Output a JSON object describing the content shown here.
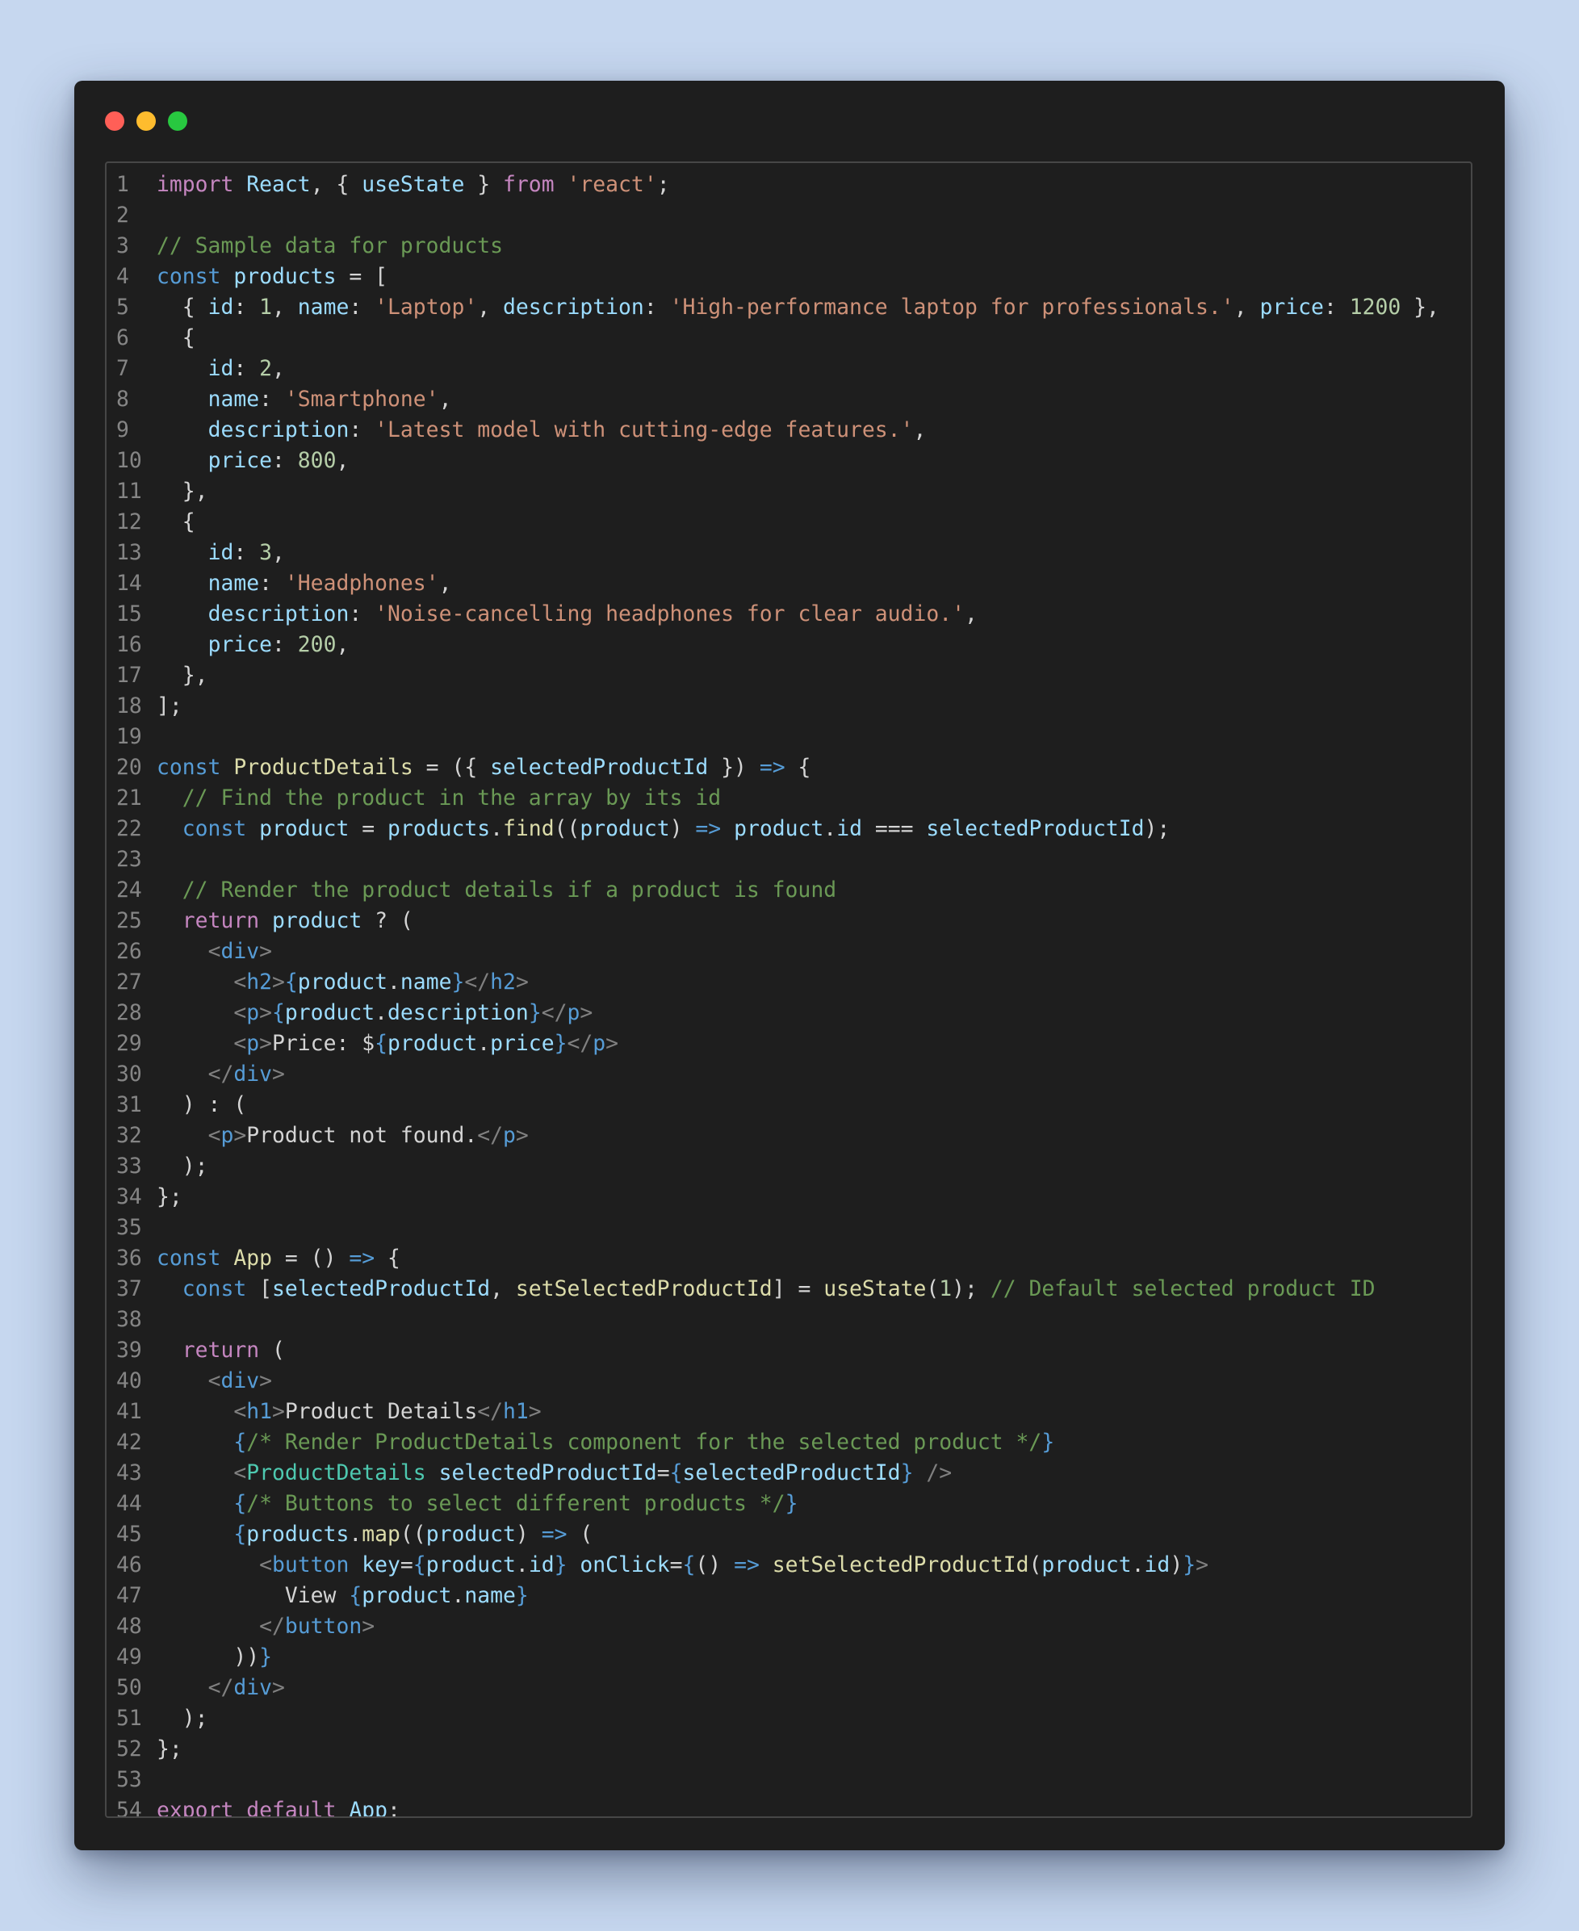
{
  "window": {
    "dots": [
      {
        "name": "close",
        "color": "#ff5f57"
      },
      {
        "name": "minimize",
        "color": "#febc2e"
      },
      {
        "name": "maximize",
        "color": "#28c840"
      }
    ]
  },
  "code": {
    "language": "javascript",
    "lines": [
      [
        [
          "import",
          "kw"
        ],
        [
          " "
        ],
        [
          "React",
          "var"
        ],
        [
          ", { "
        ],
        [
          "useState",
          "var"
        ],
        [
          " } "
        ],
        [
          "from",
          "kw"
        ],
        [
          " "
        ],
        [
          "'react'",
          "str"
        ],
        [
          ";"
        ]
      ],
      [],
      [
        [
          "// Sample data for products",
          "cm"
        ]
      ],
      [
        [
          "const",
          "st"
        ],
        [
          " "
        ],
        [
          "products",
          "var"
        ],
        [
          " = ["
        ]
      ],
      [
        [
          "  { "
        ],
        [
          "id",
          "var"
        ],
        [
          ": "
        ],
        [
          "1",
          "num"
        ],
        [
          ", "
        ],
        [
          "name",
          "var"
        ],
        [
          ": "
        ],
        [
          "'Laptop'",
          "str"
        ],
        [
          ", "
        ],
        [
          "description",
          "var"
        ],
        [
          ": "
        ],
        [
          "'High-performance laptop for professionals.'",
          "str"
        ],
        [
          ", "
        ],
        [
          "price",
          "var"
        ],
        [
          ": "
        ],
        [
          "1200",
          "num"
        ],
        [
          " },"
        ]
      ],
      [
        [
          "  {"
        ]
      ],
      [
        [
          "    "
        ],
        [
          "id",
          "var"
        ],
        [
          ": "
        ],
        [
          "2",
          "num"
        ],
        [
          ","
        ]
      ],
      [
        [
          "    "
        ],
        [
          "name",
          "var"
        ],
        [
          ": "
        ],
        [
          "'Smartphone'",
          "str"
        ],
        [
          ","
        ]
      ],
      [
        [
          "    "
        ],
        [
          "description",
          "var"
        ],
        [
          ": "
        ],
        [
          "'Latest model with cutting-edge features.'",
          "str"
        ],
        [
          ","
        ]
      ],
      [
        [
          "    "
        ],
        [
          "price",
          "var"
        ],
        [
          ": "
        ],
        [
          "800",
          "num"
        ],
        [
          ","
        ]
      ],
      [
        [
          "  },"
        ]
      ],
      [
        [
          "  {"
        ]
      ],
      [
        [
          "    "
        ],
        [
          "id",
          "var"
        ],
        [
          ": "
        ],
        [
          "3",
          "num"
        ],
        [
          ","
        ]
      ],
      [
        [
          "    "
        ],
        [
          "name",
          "var"
        ],
        [
          ": "
        ],
        [
          "'Headphones'",
          "str"
        ],
        [
          ","
        ]
      ],
      [
        [
          "    "
        ],
        [
          "description",
          "var"
        ],
        [
          ": "
        ],
        [
          "'Noise-cancelling headphones for clear audio.'",
          "str"
        ],
        [
          ","
        ]
      ],
      [
        [
          "    "
        ],
        [
          "price",
          "var"
        ],
        [
          ": "
        ],
        [
          "200",
          "num"
        ],
        [
          ","
        ]
      ],
      [
        [
          "  },"
        ]
      ],
      [
        [
          "];"
        ]
      ],
      [],
      [
        [
          "const",
          "st"
        ],
        [
          " "
        ],
        [
          "ProductDetails",
          "fn"
        ],
        [
          " = ({ "
        ],
        [
          "selectedProductId",
          "var"
        ],
        [
          " }) "
        ],
        [
          "=>",
          "st"
        ],
        [
          " {"
        ]
      ],
      [
        [
          "  "
        ],
        [
          "// Find the product in the array by its id",
          "cm"
        ]
      ],
      [
        [
          "  "
        ],
        [
          "const",
          "st"
        ],
        [
          " "
        ],
        [
          "product",
          "var"
        ],
        [
          " = "
        ],
        [
          "products",
          "var"
        ],
        [
          "."
        ],
        [
          "find",
          "fn"
        ],
        [
          "(("
        ],
        [
          "product",
          "var"
        ],
        [
          ") "
        ],
        [
          "=>",
          "st"
        ],
        [
          " "
        ],
        [
          "product",
          "var"
        ],
        [
          "."
        ],
        [
          "id",
          "var"
        ],
        [
          " === "
        ],
        [
          "selectedProductId",
          "var"
        ],
        [
          ");"
        ]
      ],
      [],
      [
        [
          "  "
        ],
        [
          "// Render the product details if a product is found",
          "cm"
        ]
      ],
      [
        [
          "  "
        ],
        [
          "return",
          "kw"
        ],
        [
          " "
        ],
        [
          "product",
          "var"
        ],
        [
          " ? ("
        ]
      ],
      [
        [
          "    "
        ],
        [
          "<",
          "tag"
        ],
        [
          "div",
          "tg"
        ],
        [
          ">",
          "tag"
        ]
      ],
      [
        [
          "      "
        ],
        [
          "<",
          "tag"
        ],
        [
          "h2",
          "tg"
        ],
        [
          ">",
          "tag"
        ],
        [
          "{",
          "st"
        ],
        [
          "product",
          "var"
        ],
        [
          "."
        ],
        [
          "name",
          "var"
        ],
        [
          "}",
          "st"
        ],
        [
          "</",
          "tag"
        ],
        [
          "h2",
          "tg"
        ],
        [
          ">",
          "tag"
        ]
      ],
      [
        [
          "      "
        ],
        [
          "<",
          "tag"
        ],
        [
          "p",
          "tg"
        ],
        [
          ">",
          "tag"
        ],
        [
          "{",
          "st"
        ],
        [
          "product",
          "var"
        ],
        [
          "."
        ],
        [
          "description",
          "var"
        ],
        [
          "}",
          "st"
        ],
        [
          "</",
          "tag"
        ],
        [
          "p",
          "tg"
        ],
        [
          ">",
          "tag"
        ]
      ],
      [
        [
          "      "
        ],
        [
          "<",
          "tag"
        ],
        [
          "p",
          "tg"
        ],
        [
          ">",
          "tag"
        ],
        [
          "Price: $"
        ],
        [
          "{",
          "st"
        ],
        [
          "product",
          "var"
        ],
        [
          "."
        ],
        [
          "price",
          "var"
        ],
        [
          "}",
          "st"
        ],
        [
          "</",
          "tag"
        ],
        [
          "p",
          "tg"
        ],
        [
          ">",
          "tag"
        ]
      ],
      [
        [
          "    "
        ],
        [
          "</",
          "tag"
        ],
        [
          "div",
          "tg"
        ],
        [
          ">",
          "tag"
        ]
      ],
      [
        [
          "  ) : ("
        ]
      ],
      [
        [
          "    "
        ],
        [
          "<",
          "tag"
        ],
        [
          "p",
          "tg"
        ],
        [
          ">",
          "tag"
        ],
        [
          "Product not found."
        ],
        [
          "</",
          "tag"
        ],
        [
          "p",
          "tg"
        ],
        [
          ">",
          "tag"
        ]
      ],
      [
        [
          "  );"
        ]
      ],
      [
        [
          "};"
        ]
      ],
      [],
      [
        [
          "const",
          "st"
        ],
        [
          " "
        ],
        [
          "App",
          "fn"
        ],
        [
          " = () "
        ],
        [
          "=>",
          "st"
        ],
        [
          " {"
        ]
      ],
      [
        [
          "  "
        ],
        [
          "const",
          "st"
        ],
        [
          " ["
        ],
        [
          "selectedProductId",
          "var"
        ],
        [
          ", "
        ],
        [
          "setSelectedProductId",
          "fn"
        ],
        [
          "] = "
        ],
        [
          "useState",
          "fn"
        ],
        [
          "("
        ],
        [
          "1",
          "num"
        ],
        [
          "); "
        ],
        [
          "// Default selected product ID",
          "cm"
        ]
      ],
      [],
      [
        [
          "  "
        ],
        [
          "return",
          "kw"
        ],
        [
          " ("
        ]
      ],
      [
        [
          "    "
        ],
        [
          "<",
          "tag"
        ],
        [
          "div",
          "tg"
        ],
        [
          ">",
          "tag"
        ]
      ],
      [
        [
          "      "
        ],
        [
          "<",
          "tag"
        ],
        [
          "h1",
          "tg"
        ],
        [
          ">",
          "tag"
        ],
        [
          "Product Details"
        ],
        [
          "</",
          "tag"
        ],
        [
          "h1",
          "tg"
        ],
        [
          ">",
          "tag"
        ]
      ],
      [
        [
          "      "
        ],
        [
          "{",
          "st"
        ],
        [
          "/* Render ProductDetails component for the selected product */",
          "cm"
        ],
        [
          "}",
          "st"
        ]
      ],
      [
        [
          "      "
        ],
        [
          "<",
          "tag"
        ],
        [
          "ProductDetails",
          "comp"
        ],
        [
          " "
        ],
        [
          "selectedProductId",
          "var"
        ],
        [
          "="
        ],
        [
          "{",
          "st"
        ],
        [
          "selectedProductId",
          "var"
        ],
        [
          "}",
          "st"
        ],
        [
          " "
        ],
        [
          "/>",
          "tag"
        ]
      ],
      [
        [
          "      "
        ],
        [
          "{",
          "st"
        ],
        [
          "/* Buttons to select different products */",
          "cm"
        ],
        [
          "}",
          "st"
        ]
      ],
      [
        [
          "      "
        ],
        [
          "{",
          "st"
        ],
        [
          "products",
          "var"
        ],
        [
          "."
        ],
        [
          "map",
          "fn"
        ],
        [
          "(("
        ],
        [
          "product",
          "var"
        ],
        [
          ") "
        ],
        [
          "=>",
          "st"
        ],
        [
          " ("
        ]
      ],
      [
        [
          "        "
        ],
        [
          "<",
          "tag"
        ],
        [
          "button",
          "tg"
        ],
        [
          " "
        ],
        [
          "key",
          "var"
        ],
        [
          "="
        ],
        [
          "{",
          "st"
        ],
        [
          "product",
          "var"
        ],
        [
          "."
        ],
        [
          "id",
          "var"
        ],
        [
          "}",
          "st"
        ],
        [
          " "
        ],
        [
          "onClick",
          "var"
        ],
        [
          "="
        ],
        [
          "{",
          "st"
        ],
        [
          "() "
        ],
        [
          "=>",
          "st"
        ],
        [
          " "
        ],
        [
          "setSelectedProductId",
          "fn"
        ],
        [
          "("
        ],
        [
          "product",
          "var"
        ],
        [
          "."
        ],
        [
          "id",
          "var"
        ],
        [
          ")"
        ],
        [
          "}",
          "st"
        ],
        [
          ">",
          "tag"
        ]
      ],
      [
        [
          "          View "
        ],
        [
          "{",
          "st"
        ],
        [
          "product",
          "var"
        ],
        [
          "."
        ],
        [
          "name",
          "var"
        ],
        [
          "}",
          "st"
        ]
      ],
      [
        [
          "        "
        ],
        [
          "</",
          "tag"
        ],
        [
          "button",
          "tg"
        ],
        [
          ">",
          "tag"
        ]
      ],
      [
        [
          "      ))"
        ],
        [
          "}",
          "st"
        ]
      ],
      [
        [
          "    "
        ],
        [
          "</",
          "tag"
        ],
        [
          "div",
          "tg"
        ],
        [
          ">",
          "tag"
        ]
      ],
      [
        [
          "  );"
        ]
      ],
      [
        [
          "};"
        ]
      ],
      [],
      [
        [
          "export",
          "kw"
        ],
        [
          " "
        ],
        [
          "default",
          "kw"
        ],
        [
          " "
        ],
        [
          "App",
          "var"
        ],
        [
          ";"
        ]
      ]
    ]
  }
}
